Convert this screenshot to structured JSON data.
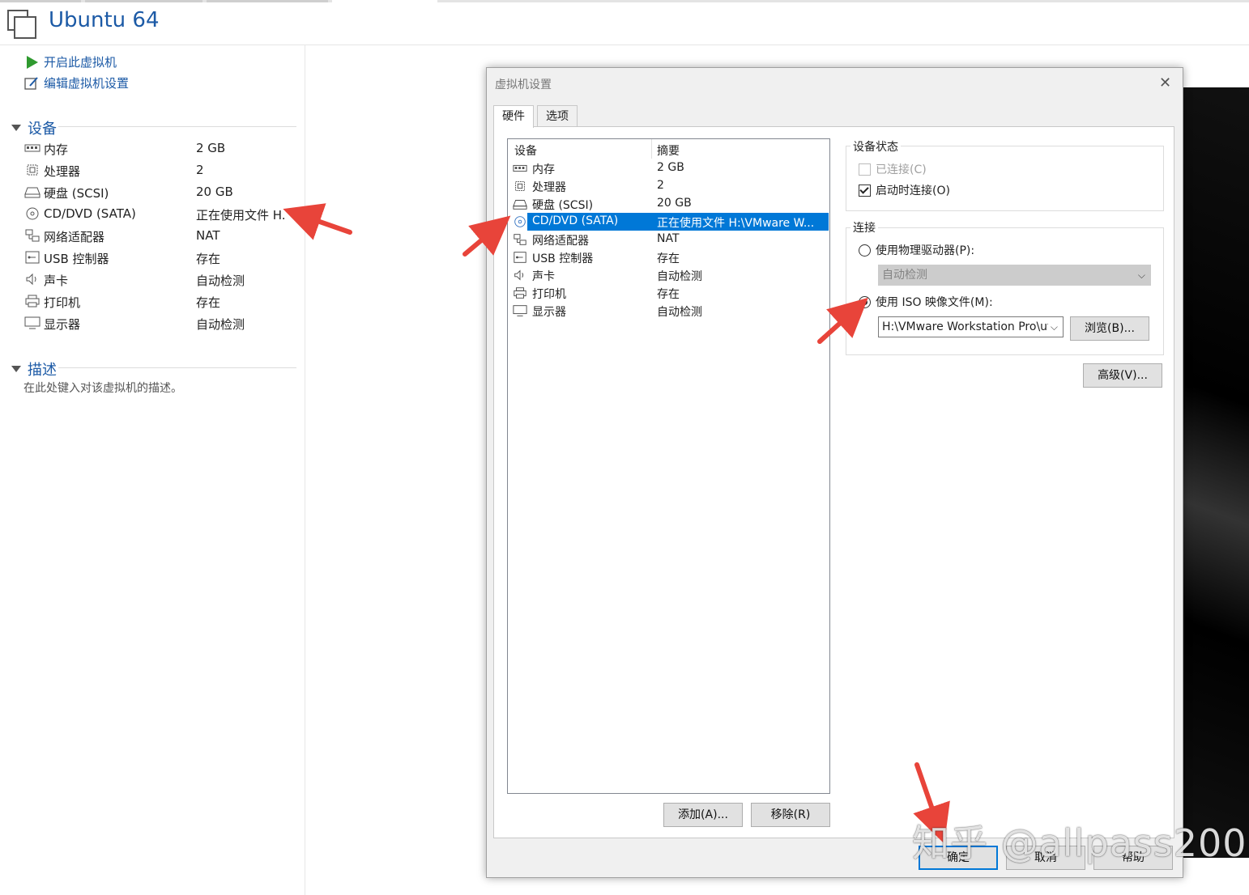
{
  "vm": {
    "title": "Ubuntu 64"
  },
  "actions": [
    {
      "label": "开启此虚拟机",
      "icon": "play-icon"
    },
    {
      "label": "编辑虚拟机设置",
      "icon": "edit-settings-icon"
    }
  ],
  "sections": {
    "devices_label": "设备",
    "description_label": "描述",
    "description_text": "在此处键入对该虚拟机的描述。"
  },
  "devices": [
    {
      "name": "内存",
      "value": "2 GB",
      "icon": "memory-icon"
    },
    {
      "name": "处理器",
      "value": "2",
      "icon": "cpu-icon"
    },
    {
      "name": "硬盘 (SCSI)",
      "value": "20 GB",
      "icon": "harddisk-icon"
    },
    {
      "name": "CD/DVD (SATA)",
      "value": "正在使用文件 H.",
      "icon": "cd-dvd-icon"
    },
    {
      "name": "网络适配器",
      "value": "NAT",
      "icon": "network-icon"
    },
    {
      "name": "USB 控制器",
      "value": "存在",
      "icon": "usb-icon"
    },
    {
      "name": "声卡",
      "value": "自动检测",
      "icon": "sound-icon"
    },
    {
      "name": "打印机",
      "value": "存在",
      "icon": "printer-icon"
    },
    {
      "name": "显示器",
      "value": "自动检测",
      "icon": "display-icon"
    }
  ],
  "dialog": {
    "title": "虚拟机设置",
    "close_glyph": "✕",
    "tabs": [
      "硬件",
      "选项"
    ],
    "list_header": {
      "device": "设备",
      "summary": "摘要"
    },
    "hardware": [
      {
        "name": "内存",
        "value": "2 GB"
      },
      {
        "name": "处理器",
        "value": "2"
      },
      {
        "name": "硬盘 (SCSI)",
        "value": "20 GB"
      },
      {
        "name": "CD/DVD (SATA)",
        "value": "正在使用文件 H:\\VMware W...",
        "selected": true
      },
      {
        "name": "网络适配器",
        "value": "NAT"
      },
      {
        "name": "USB 控制器",
        "value": "存在"
      },
      {
        "name": "声卡",
        "value": "自动检测"
      },
      {
        "name": "打印机",
        "value": "存在"
      },
      {
        "name": "显示器",
        "value": "自动检测"
      }
    ],
    "add_button": "添加(A)...",
    "remove_button": "移除(R)",
    "device_status": {
      "label": "设备状态",
      "connected": "已连接(C)",
      "connect_at_power_on": "启动时连接(O)"
    },
    "connection": {
      "label": "连接",
      "physical_drive": "使用物理驱动器(P):",
      "physical_drive_value": "自动检测",
      "iso_file": "使用 ISO 映像文件(M):",
      "iso_path": "H:\\VMware Workstation Pro\\ut",
      "browse_button": "浏览(B)..."
    },
    "advanced_button": "高级(V)...",
    "ok_button": "确定",
    "cancel_button": "取消",
    "help_button": "帮助"
  },
  "watermark": "知乎 @allpass200",
  "colors": {
    "accent": "#0078d7",
    "link": "#1c5aa6",
    "arrow": "#e8443a"
  }
}
